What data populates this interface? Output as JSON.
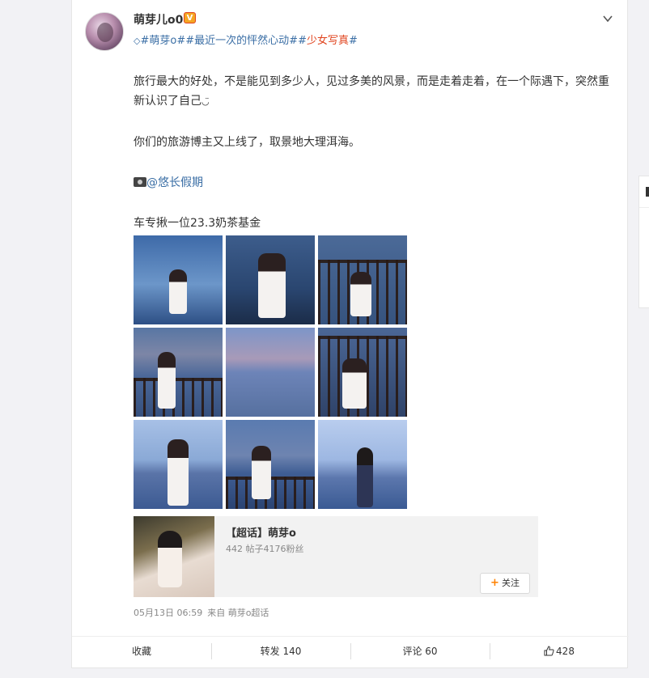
{
  "post": {
    "username": "萌芽儿o0",
    "verified_badge": "V",
    "topics": [
      "萌芽o",
      "最近一次的怦然心动",
      "少女写真"
    ],
    "paragraphs": [
      "旅行最大的好处，不是能见到多少人，见过多美的风景，而是走着走着，在一个际遇下，突然重新认识了自己",
      "你们的旅游博主又上线了，取景地大理洱海。"
    ],
    "mention": "@悠长假期",
    "footer_line": "车专揪一位23.3奶茶基金",
    "smile_glyph": "◡̈",
    "photos_count": 9
  },
  "super_topic": {
    "title": "【超话】萌芽o",
    "stats": "442 帖子4176粉丝",
    "follow_label": "关注",
    "follow_plus": "+"
  },
  "meta": {
    "timestamp": "05月13日 06:59",
    "source": "来自 萌芽o超话"
  },
  "actions": {
    "favorite": "收藏",
    "repost": "转发 140",
    "comment": "评论 60",
    "like": "428"
  },
  "icons": {
    "chevron": "chevron-down-icon",
    "topic_marker": "diamond-icon",
    "camera": "camera-icon",
    "like": "thumbs-up-icon"
  },
  "colors": {
    "link": "#3a6ea5",
    "highlight": "#e0431d",
    "follow_plus": "#ff8200"
  }
}
